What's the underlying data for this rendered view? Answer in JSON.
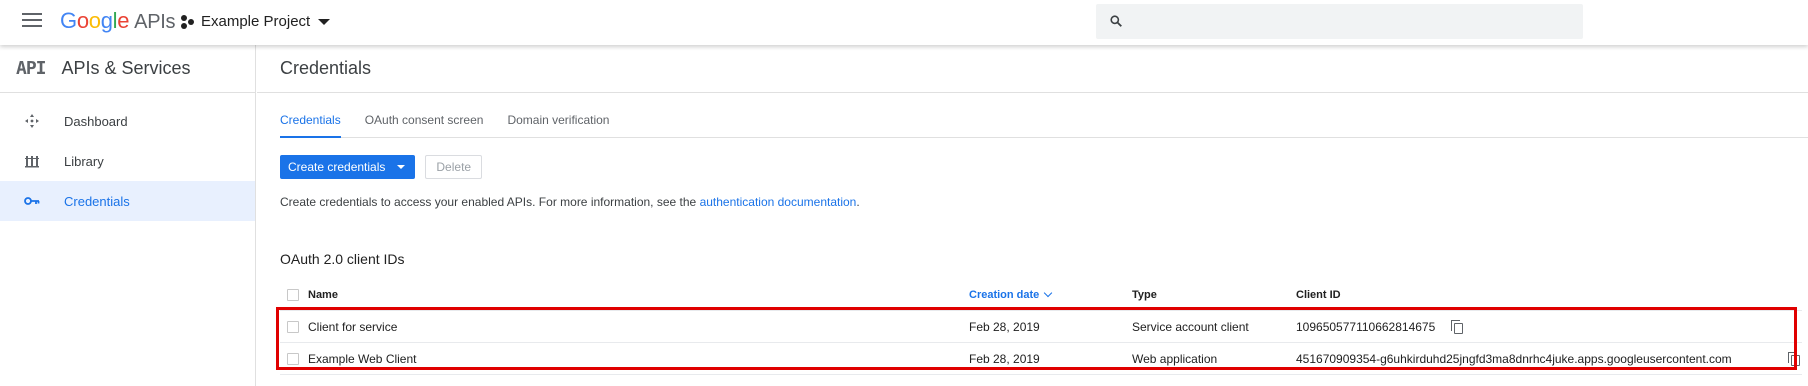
{
  "header": {
    "logo_google": [
      "G",
      "o",
      "o",
      "g",
      "l",
      "e"
    ],
    "logo_apis": "APIs",
    "project_name": "Example Project"
  },
  "sidebar": {
    "logo": "API",
    "title": "APIs & Services",
    "items": [
      {
        "label": "Dashboard",
        "icon": "dashboard-icon"
      },
      {
        "label": "Library",
        "icon": "library-icon"
      },
      {
        "label": "Credentials",
        "icon": "key-icon",
        "active": true
      }
    ]
  },
  "main": {
    "title": "Credentials",
    "tabs": [
      {
        "label": "Credentials",
        "active": true
      },
      {
        "label": "OAuth consent screen"
      },
      {
        "label": "Domain verification"
      }
    ],
    "create_label": "Create credentials",
    "delete_label": "Delete",
    "description": "Create credentials to access your enabled APIs. For more information, see the",
    "description_link": "authentication documentation",
    "description_end": ".",
    "section_title": "OAuth 2.0 client IDs",
    "table": {
      "columns": [
        "Name",
        "Creation date",
        "Type",
        "Client ID"
      ],
      "rows": [
        {
          "name": "Client for service",
          "date": "Feb 28, 2019",
          "type": "Service account client",
          "client_id": "109650577110662814675"
        },
        {
          "name": "Example Web Client",
          "date": "Feb 28, 2019",
          "type": "Web application",
          "client_id": "451670909354-g6uhkirduhd25jngfd3ma8dnrhc4juke.apps.googleusercontent.com"
        }
      ]
    }
  },
  "colors": {
    "accent": "#1a73e8",
    "highlight": "#e00000",
    "active_bg": "#e8f0fe"
  }
}
